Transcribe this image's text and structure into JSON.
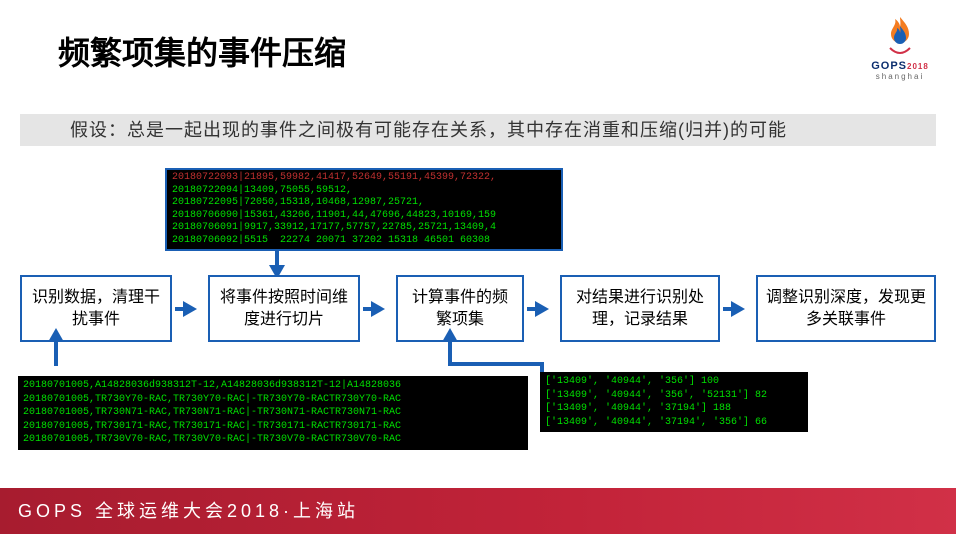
{
  "title": "频繁项集的事件压缩",
  "logo": {
    "brand": "GOPS",
    "year": "2018",
    "city": "shanghai"
  },
  "hypothesis": "假设：总是一起出现的事件之间极有可能存在关系，其中存在消重和压缩(归并)的可能",
  "terminal1_first": "20180722093|21895,59982,41417,52649,55191,45399,72322,",
  "terminal1_rest": "20180722094|13409,75055,59512,\n20180722095|72050,15318,10468,12987,25721,\n20180706090|15361,43206,11901,44,47696,44823,10169,159\n20180706091|9917,33912,17177,57757,22785,25721,13409,4\n20180706092|5515  22274 20071 37202 15318 46501 60308",
  "boxes": [
    "识别数据，清理干扰事件",
    "将事件按照时间维度进行切片",
    "计算事件的频繁项集",
    "对结果进行识别处理，记录结果",
    "调整识别深度，发现更多关联事件"
  ],
  "terminal2": "20180701005,A14828036d938312T-12,A14828036d938312T-12|A14828036\n20180701005,TR730Y70-RAC,TR730Y70-RAC|-TR730Y70-RACTR730Y70-RAC\n20180701005,TR730N71-RAC,TR730N71-RAC|-TR730N71-RACTR730N71-RAC\n20180701005,TR730171-RAC,TR730171-RAC|-TR730171-RACTR730171-RAC\n20180701005,TR730V70-RAC,TR730V70-RAC|-TR730V70-RACTR730V70-RAC",
  "terminal3": "['13409', '40944', '356'] 100\n['13409', '40944', '356', '52131'] 82\n['13409', '40944', '37194'] 188\n['13409', '40944', '37194', '356'] 66",
  "footer": "GOPS 全球运维大会2018·上海站"
}
